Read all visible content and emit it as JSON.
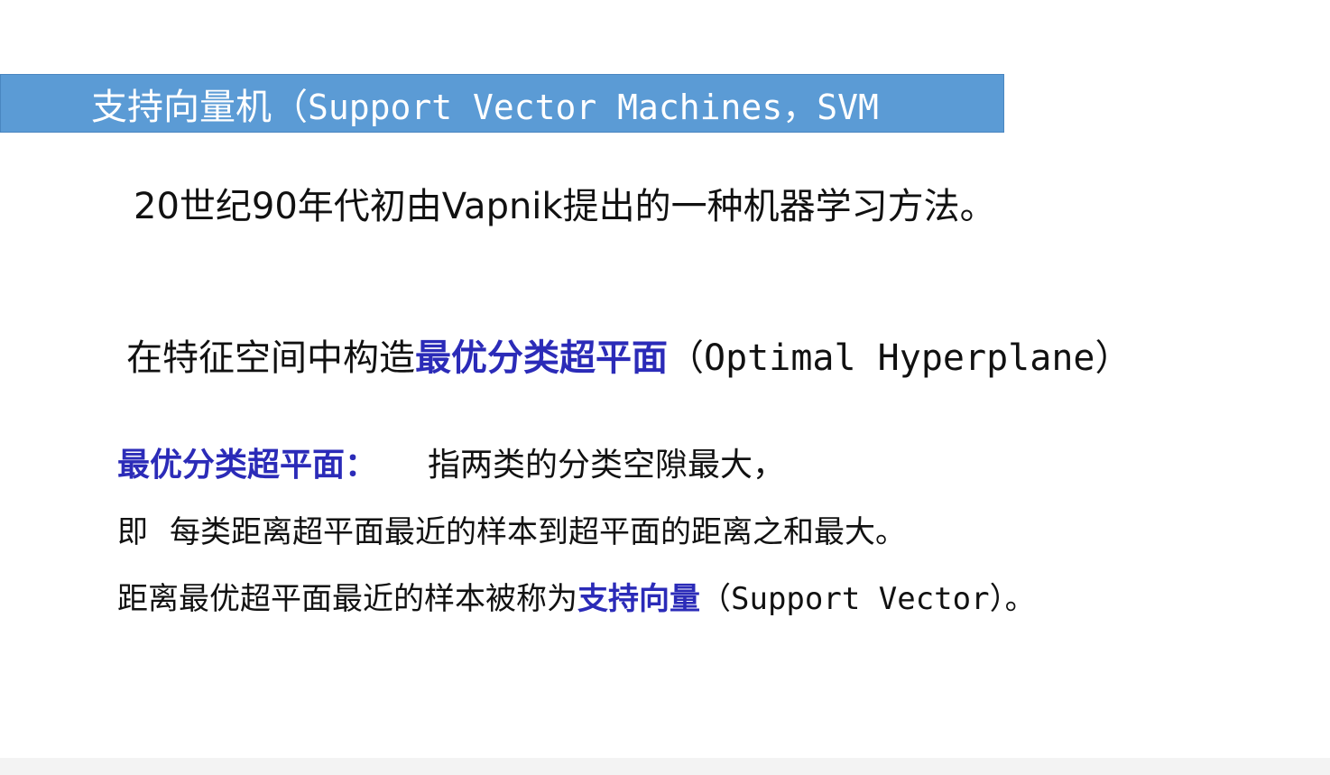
{
  "title": {
    "cn": "支持向量机",
    "paren_open": "（",
    "en": "Support Vector Machines，SVM"
  },
  "intro": "20世纪90年代初由Vapnik提出的一种机器学习方法。",
  "construct": {
    "prefix": "在特征空间中构造",
    "term": "最优分类超平面",
    "paren_open": "（",
    "en": "Optimal Hyperplane",
    "paren_close": "）"
  },
  "definition": {
    "term": "最优分类超平面",
    "colon": "：",
    "text": "指两类的分类空隙最大，"
  },
  "definition_cont": {
    "prefix": "即",
    "text": "每类距离超平面最近的样本到超平面的距离之和最大。"
  },
  "support_vector": {
    "prefix": "距离最优超平面最近的样本被称为",
    "term": "支持向量",
    "paren_open": "（",
    "en": "Support Vector",
    "suffix": "）。"
  }
}
